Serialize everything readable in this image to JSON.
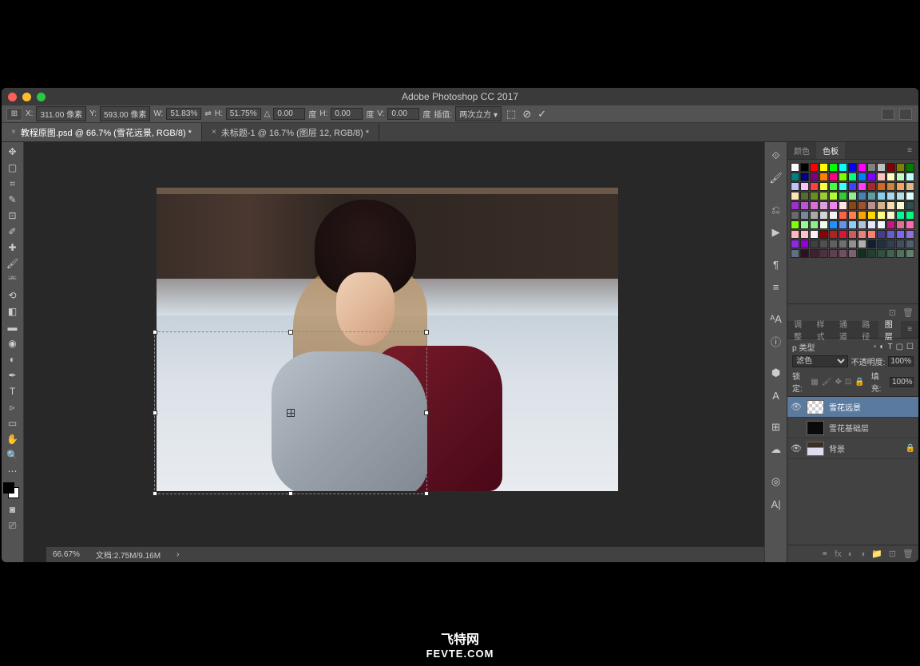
{
  "title": "Adobe Photoshop CC 2017",
  "options": {
    "x_label": "X:",
    "x_value": "311.00 像素",
    "y_label": "Y:",
    "y_value": "593.00 像素",
    "w_label": "W:",
    "w_value": "51.83%",
    "h_label": "H:",
    "h_value": "51.75%",
    "angle_label": "△",
    "angle_value": "0.00",
    "angle_unit": "度",
    "h2_label": "H:",
    "h2_value": "0.00",
    "h2_unit": "度",
    "v_label": "V:",
    "v_value": "0.00",
    "v_unit": "度",
    "interp_label": "插值:",
    "interp_value": "两次立方"
  },
  "tabs": [
    {
      "label": "教程原图.psd @ 66.7% (雪花远景, RGB/8) *",
      "active": true
    },
    {
      "label": "未标题-1 @ 16.7% (图层 12, RGB/8) *",
      "active": false
    }
  ],
  "status": {
    "zoom": "66.67%",
    "doc": "文档:2.75M/9.16M"
  },
  "swatch_panel": {
    "tabs": [
      "颜色",
      "色板"
    ],
    "active": 1
  },
  "layers_panel": {
    "tabs": [
      "调整",
      "样式",
      "通道",
      "路径",
      "图层"
    ],
    "active": 4,
    "filter_label": "p 类型",
    "blend": "滤色",
    "opacity_label": "不透明度:",
    "opacity_value": "100%",
    "lock_label": "锁定:",
    "fill_label": "填充:",
    "fill_value": "100%",
    "layers": [
      {
        "name": "雪花远景",
        "visible": true,
        "selected": true,
        "thumb": "checker"
      },
      {
        "name": "雪花基础层",
        "visible": false,
        "selected": false,
        "thumb": "dark"
      },
      {
        "name": "背景",
        "visible": true,
        "selected": false,
        "thumb": "img",
        "locked": true
      }
    ]
  },
  "swatch_colors": [
    "#ffffff",
    "#000000",
    "#ff0000",
    "#ffff00",
    "#00ff00",
    "#00ffff",
    "#0000ff",
    "#ff00ff",
    "#808080",
    "#c0c0c0",
    "#800000",
    "#808000",
    "#008000",
    "#008080",
    "#000080",
    "#800080",
    "#ff8000",
    "#ff0080",
    "#80ff00",
    "#00ff80",
    "#0080ff",
    "#8000ff",
    "#ffc0c0",
    "#ffffc0",
    "#c0ffc0",
    "#c0ffff",
    "#c0c0ff",
    "#ffc0ff",
    "#ff4040",
    "#ffff40",
    "#40ff40",
    "#40ffff",
    "#4040ff",
    "#ff40ff",
    "#a52a2a",
    "#d2691e",
    "#cd853f",
    "#f4a460",
    "#deb887",
    "#ffe4b5",
    "#556b2f",
    "#6b8e23",
    "#9acd32",
    "#adff2f",
    "#32cd32",
    "#90ee90",
    "#4682b4",
    "#5f9ea0",
    "#87ceeb",
    "#add8e6",
    "#b0e0e6",
    "#e0ffff",
    "#9932cc",
    "#ba55d3",
    "#da70d6",
    "#dda0dd",
    "#ee82ee",
    "#ffe4e1",
    "#8b4513",
    "#a0522d",
    "#bc8f8f",
    "#d2b48c",
    "#f5deb3",
    "#fafad2",
    "#2f4f4f",
    "#696969",
    "#778899",
    "#a9a9a9",
    "#d3d3d3",
    "#f5f5f5",
    "#ff6347",
    "#ff7f50",
    "#ffa500",
    "#ffd700",
    "#ffff80",
    "#fffacd",
    "#00fa9a",
    "#00ff7f",
    "#7fff00",
    "#98fb98",
    "#90ee90",
    "#f0fff0",
    "#1e90ff",
    "#6495ed",
    "#87cefa",
    "#b0c4de",
    "#e6e6fa",
    "#f0f8ff",
    "#c71585",
    "#db7093",
    "#ff69b4",
    "#ffb6c1",
    "#ffc0cb",
    "#fff0f5",
    "#8b0000",
    "#b22222",
    "#dc143c",
    "#cd5c5c",
    "#f08080",
    "#fa8072",
    "#483d8b",
    "#6a5acd",
    "#7b68ee",
    "#9370db",
    "#8a2be2",
    "#9400d3",
    "#404040",
    "#505050",
    "#606060",
    "#707070",
    "#909090",
    "#b0b0b0",
    "#102030",
    "#203040",
    "#304050",
    "#405060",
    "#506070",
    "#607080",
    "#301020",
    "#402030",
    "#503040",
    "#604050",
    "#705060",
    "#806070",
    "#103020",
    "#204030",
    "#305040",
    "#406050",
    "#507060",
    "#608070"
  ],
  "footer": {
    "line1": "飞特网",
    "line2": "FEVTE.COM"
  }
}
